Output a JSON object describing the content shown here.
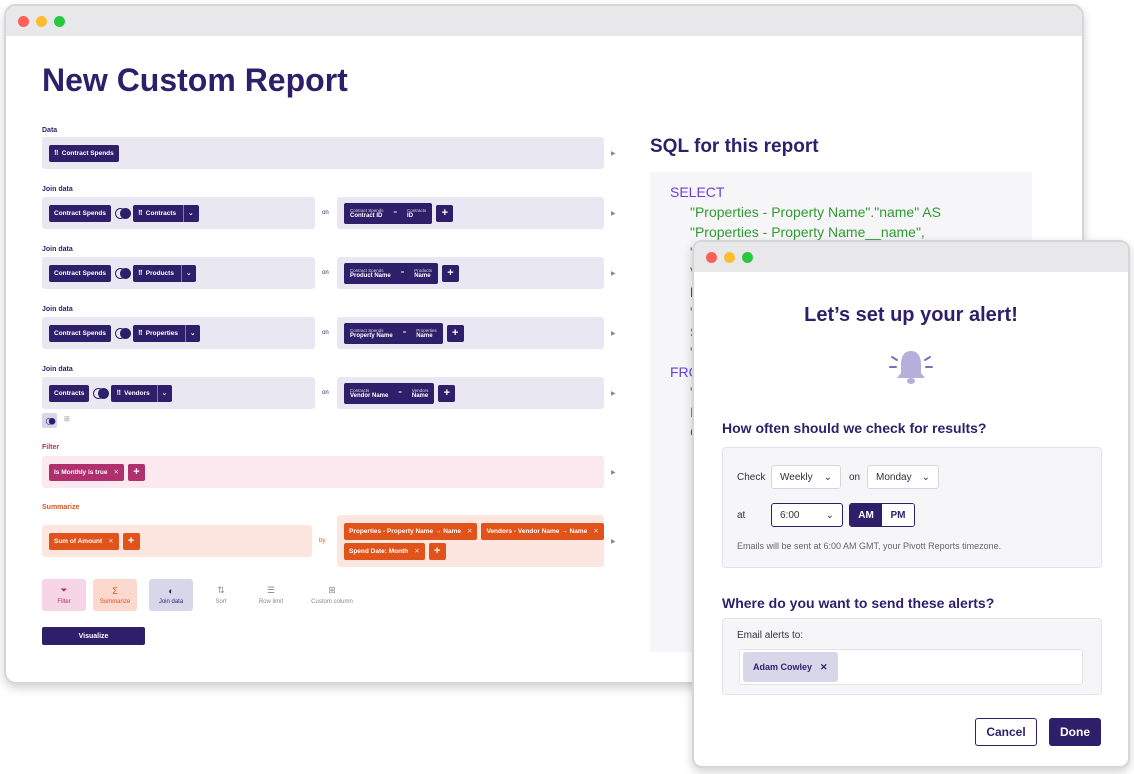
{
  "report": {
    "title": "New Custom Report",
    "data_label": "Data",
    "data_chip": "Contract Spends",
    "join_label": "Join data",
    "on_label": "on",
    "joins": [
      {
        "left": "Contract Spends",
        "right": "Contracts",
        "cond_left_table": "Contract Spends",
        "cond_left_col": "Contract ID",
        "cond_right_table": "Contracts",
        "cond_right_col": "ID"
      },
      {
        "left": "Contract Spends",
        "right": "Products",
        "cond_left_table": "Contract Spends",
        "cond_left_col": "Product Name",
        "cond_right_table": "Products",
        "cond_right_col": "Name"
      },
      {
        "left": "Contract Spends",
        "right": "Properties",
        "cond_left_table": "Contract Spends",
        "cond_left_col": "Property Name",
        "cond_right_table": "Properties",
        "cond_right_col": "Name"
      },
      {
        "left": "Contracts",
        "right": "Vendors",
        "cond_left_table": "Contracts",
        "cond_left_col": "Vendor Name",
        "cond_right_table": "Vendors",
        "cond_right_col": "Name"
      }
    ],
    "filter_label": "Filter",
    "filter_chip": "Is Monthly is true",
    "summarize_label": "Summarize",
    "summarize_chip": "Sum of Amount",
    "by_label": "by",
    "group_chips": [
      "Properties - Property Name → Name",
      "Vendors - Vendor Name → Name",
      "Spend Date: Month"
    ],
    "tools": [
      "Filter",
      "Summarize",
      "Join data",
      "Sort",
      "Row limit",
      "Custom column"
    ],
    "visualize": "Visualize",
    "sql_title": "SQL for this report",
    "sql_lines": [
      {
        "kw": "SELECT",
        "str": ""
      },
      {
        "kw": "",
        "str": "\"Properties - Property Name\".\"name\" AS"
      },
      {
        "kw": "",
        "str": "\"Properties - Property Name__name\","
      },
      {
        "kw": "",
        "str": "\""
      },
      {
        "kw": "",
        "str": "V"
      },
      {
        "kw": "",
        "str": "D"
      },
      {
        "kw": "",
        "str": "\""
      },
      {
        "kw": "S",
        "str": ""
      },
      {
        "kw": "",
        "str": "\""
      },
      {
        "kw": "FRO",
        "str": ""
      },
      {
        "kw": "",
        "str": "\""
      },
      {
        "kw": "I",
        "str": ""
      },
      {
        "kw": "C",
        "str": ""
      }
    ]
  },
  "alert": {
    "title": "Let’s set up your alert!",
    "frequency_heading": "How often should we check for results?",
    "check_label": "Check",
    "check_value": "Weekly",
    "on_label": "on",
    "day_value": "Monday",
    "at_label": "at",
    "time_value": "6:00",
    "am": "AM",
    "pm": "PM",
    "hint": "Emails will be sent at 6:00 AM GMT, your Pivott Reports timezone.",
    "send_heading": "Where do you want to send these alerts?",
    "email_label": "Email alerts to:",
    "recipient": "Adam Cowley",
    "cancel": "Cancel",
    "done": "Done"
  },
  "colors": {
    "brand": "#2e1f6b",
    "filter": "#b0306e",
    "summarize": "#e0531a"
  }
}
